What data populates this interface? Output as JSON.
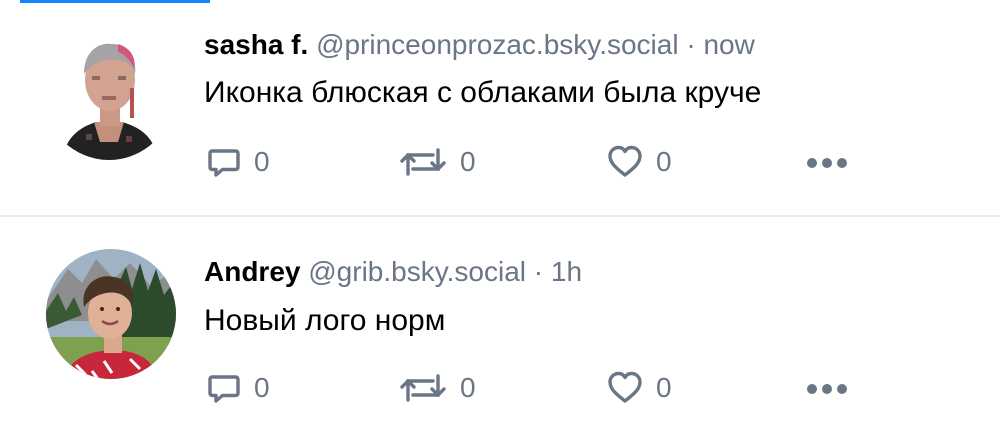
{
  "feed": {
    "posts": [
      {
        "author_name": "sasha f.",
        "handle": "@princeonprozac.bsky.social",
        "separator": "·",
        "time": "now",
        "text": "Иконка блюская с облаками была круче",
        "reply_count": "0",
        "repost_count": "0",
        "like_count": "0",
        "icons": [
          "reply-icon",
          "repost-icon",
          "like-icon",
          "more-icon"
        ]
      },
      {
        "author_name": "Andrey",
        "handle": "@grib.bsky.social",
        "separator": "·",
        "time": "1h",
        "text": "Новый лого норм",
        "reply_count": "0",
        "repost_count": "0",
        "like_count": "0",
        "icons": [
          "reply-icon",
          "repost-icon",
          "like-icon",
          "more-icon"
        ]
      }
    ]
  },
  "colors": {
    "icon": "#6a7585",
    "muted_text": "#6a7585",
    "divider": "#f1e6ea",
    "accent": "#1185fe"
  }
}
